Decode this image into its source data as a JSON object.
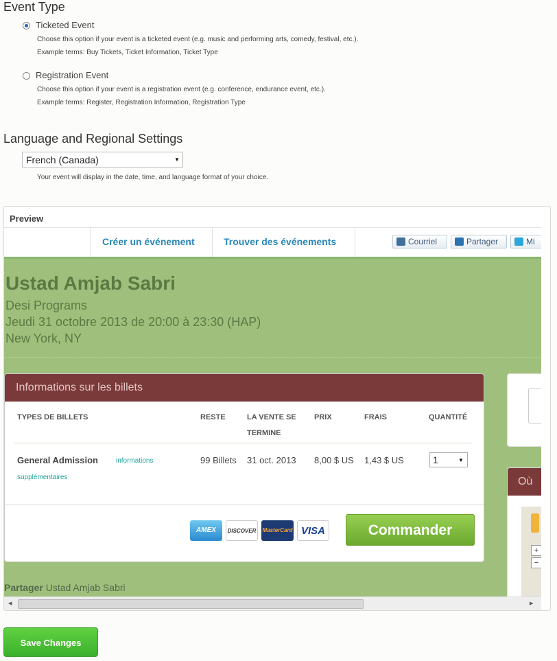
{
  "event_type": {
    "heading": "Event Type",
    "options": [
      {
        "label": "Ticketed Event",
        "selected": true,
        "help": "Choose this option if your event is a ticketed event (e.g. music and performing arts, comedy, festival, etc.).",
        "terms": "Example terms: Buy Tickets, Ticket Information, Ticket Type"
      },
      {
        "label": "Registration Event",
        "selected": false,
        "help": "Choose this option if your event is a registration event (e.g. conference, endurance event, etc.).",
        "terms": "Example terms: Register, Registration Information, Registration Type"
      }
    ]
  },
  "language": {
    "heading": "Language and Regional Settings",
    "selected": "French (Canada)",
    "help": "Your event will display in the date, time, and language format of your choice."
  },
  "preview": {
    "label": "Preview",
    "nav": {
      "create": "Créer un événement",
      "find": "Trouver des événements"
    },
    "share_buttons": [
      "Courriel",
      "Partager",
      "Mi"
    ],
    "event": {
      "title": "Ustad Amjab Sabri",
      "organizer": "Desi Programs",
      "datetime": "Jeudi 31 octobre 2013 de 20:00 à 23:30 (HAP)",
      "location": "New York, NY"
    },
    "tickets": {
      "header": "Informations sur les billets",
      "columns": {
        "type": "TYPES DE BILLETS",
        "remaining": "RESTE",
        "sale_end_1": "LA VENTE SE",
        "sale_end_2": "TERMINE",
        "price": "PRIX",
        "fees": "FRAIS",
        "quantity": "QUANTITÉ"
      },
      "rows": [
        {
          "name": "General Admission",
          "more_1": "informations",
          "more_2": "supplémentaires",
          "remaining": "99 Billets",
          "sale_end": "31 oct. 2013",
          "price": "8,00 $ US",
          "fees": "1,43 $ US",
          "quantity": "1"
        }
      ],
      "cards": [
        "AMEX",
        "DISCOVER",
        "MasterCard",
        "VISA"
      ],
      "order_button": "Commander"
    },
    "side_heading": "Où",
    "share_label": "Partager",
    "share_name": "Ustad Amjab Sabri"
  },
  "save_button": "Save Changes",
  "colors": {
    "accent_green": "#3bb02c",
    "page_green": "#9fc07c",
    "ticket_header": "#7a3a3a",
    "link_blue": "#2a87b6"
  }
}
